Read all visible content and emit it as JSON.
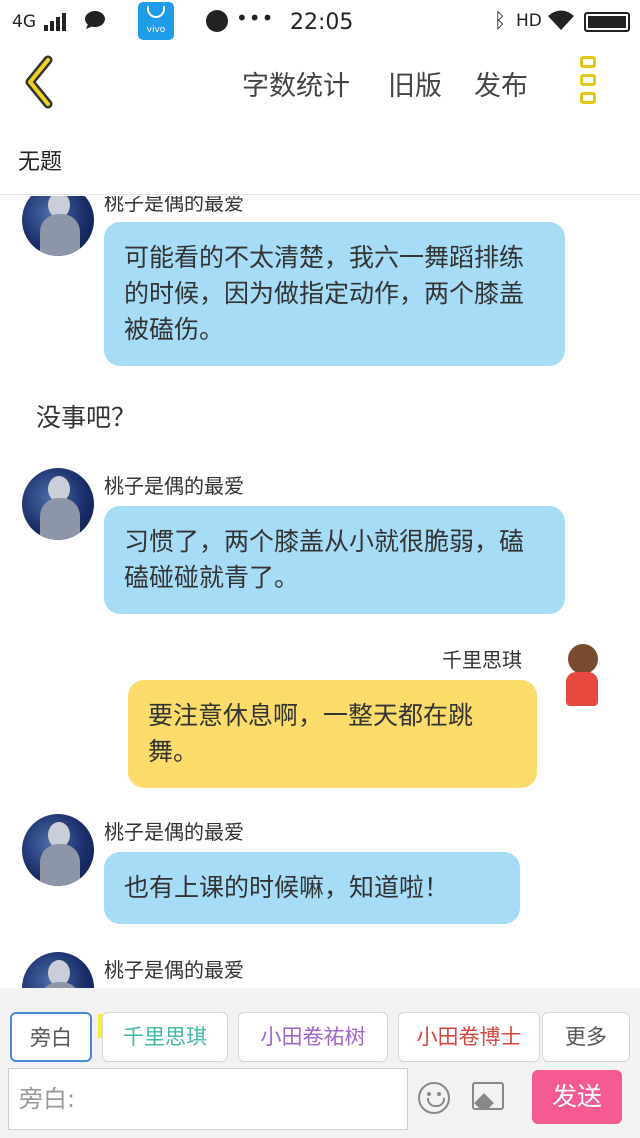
{
  "status_bar": {
    "network": "4G",
    "time": "22:05",
    "hd": "HD",
    "vivo_label": "vivo"
  },
  "header": {
    "word_count": "字数统计",
    "old_version": "旧版",
    "publish": "发布"
  },
  "title": "无题",
  "messages": [
    {
      "sender": "桃子是偶的最爱",
      "text": "可能看的不太清楚，我六一舞蹈排练的时候，因为做指定动作，两个膝盖被磕伤。"
    },
    {
      "narration": "没事吧？"
    },
    {
      "sender": "桃子是偶的最爱",
      "text": "习惯了，两个膝盖从小就很脆弱，磕磕碰碰就青了。"
    },
    {
      "sender": "千里思琪",
      "text": "要注意休息啊，一整天都在跳舞。"
    },
    {
      "sender": "桃子是偶的最爱",
      "text": "也有上课的时候嘛，知道啦！"
    },
    {
      "sender": "桃子是偶的最爱"
    }
  ],
  "roles": {
    "narrator": "旁白",
    "owner_tag": "主",
    "role1": "千里思琪",
    "role2": "小田卷祐树",
    "role3": "小田卷博士",
    "more": "更多"
  },
  "colors": {
    "role1": "#3fb8a8",
    "role2": "#a066c9",
    "role3": "#d9453c",
    "send": "#f55a93",
    "accent_yellow": "#e6c615",
    "bubble_blue": "#a6dcf6",
    "bubble_yellow": "#fbdc6b"
  },
  "input": {
    "placeholder": "旁白:",
    "send_label": "发送"
  },
  "icons": {
    "back": "chevron-left-icon",
    "menu": "vertical-menu-icon",
    "emoji": "emoji-icon",
    "image": "image-icon"
  }
}
